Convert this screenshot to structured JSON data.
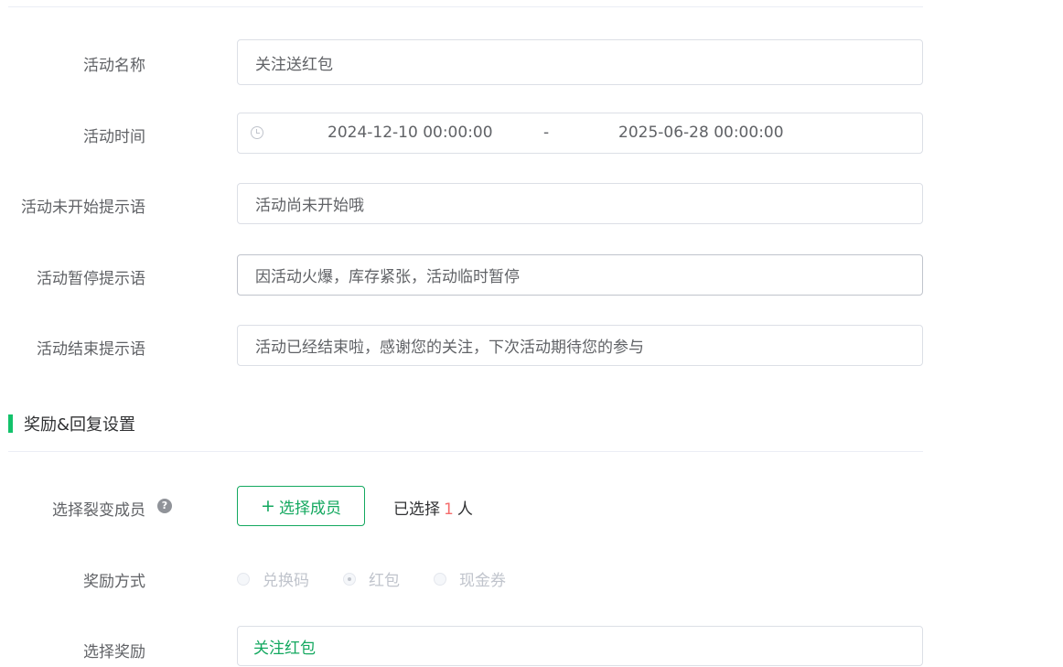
{
  "form": {
    "activity_name": {
      "label": "活动名称",
      "value": "关注送红包"
    },
    "activity_time": {
      "label": "活动时间",
      "start": "2024-12-10 00:00:00",
      "separator": "-",
      "end": "2025-06-28 00:00:00",
      "icon": "clock-icon"
    },
    "not_started_tip": {
      "label": "活动未开始提示语",
      "value": "活动尚未开始哦"
    },
    "paused_tip": {
      "label": "活动暂停提示语",
      "value": "因活动火爆，库存紧张，活动临时暂停"
    },
    "ended_tip": {
      "label": "活动结束提示语",
      "value": "活动已经结束啦，感谢您的关注，下次活动期待您的参与"
    }
  },
  "reward_section": {
    "title": "奖励&回复设置",
    "accent_color": "#13c26b",
    "select_member": {
      "label": "选择裂变成员",
      "help_icon": "?",
      "button_label": "选择成员",
      "button_icon": "+",
      "selected_prefix": "已选择",
      "selected_count": "1",
      "selected_suffix": "人"
    },
    "reward_method": {
      "label": "奖励方式",
      "options": [
        {
          "label": "兑换码",
          "checked": false
        },
        {
          "label": "红包",
          "checked": true
        },
        {
          "label": "现金券",
          "checked": false
        }
      ]
    },
    "select_reward": {
      "label": "选择奖励",
      "value": "关注红包"
    }
  }
}
